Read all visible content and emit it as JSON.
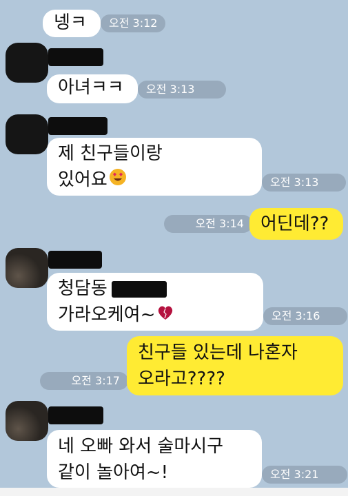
{
  "messages": [
    {
      "text": "넹ㅋ",
      "time": "오전 3:12"
    },
    {
      "text": "아녀ㅋㅋ",
      "time": "오전 3:13"
    },
    {
      "lines": [
        "제 친구들이랑",
        "있어요"
      ],
      "emoji": "heart-eyes-emoji",
      "time": "오전 3:13"
    },
    {
      "text": "어딘데??",
      "time": "오전 3:14"
    },
    {
      "lines": [
        "청담동",
        "가라오케여~"
      ],
      "emoji": "heart-emoji",
      "time": "오전 3:16"
    },
    {
      "lines": [
        "친구들 있는데 나혼자",
        "오라고????"
      ],
      "time": "오전 3:17"
    },
    {
      "lines": [
        "네 오빠 와서 술마시구",
        "같이 놀아여~!"
      ],
      "time": "오전 3:21"
    }
  ],
  "colors": {
    "background": "#b2c7da",
    "incoming_bubble": "#ffffff",
    "outgoing_bubble": "#ffeb33",
    "redaction": "#0d0d0d"
  }
}
